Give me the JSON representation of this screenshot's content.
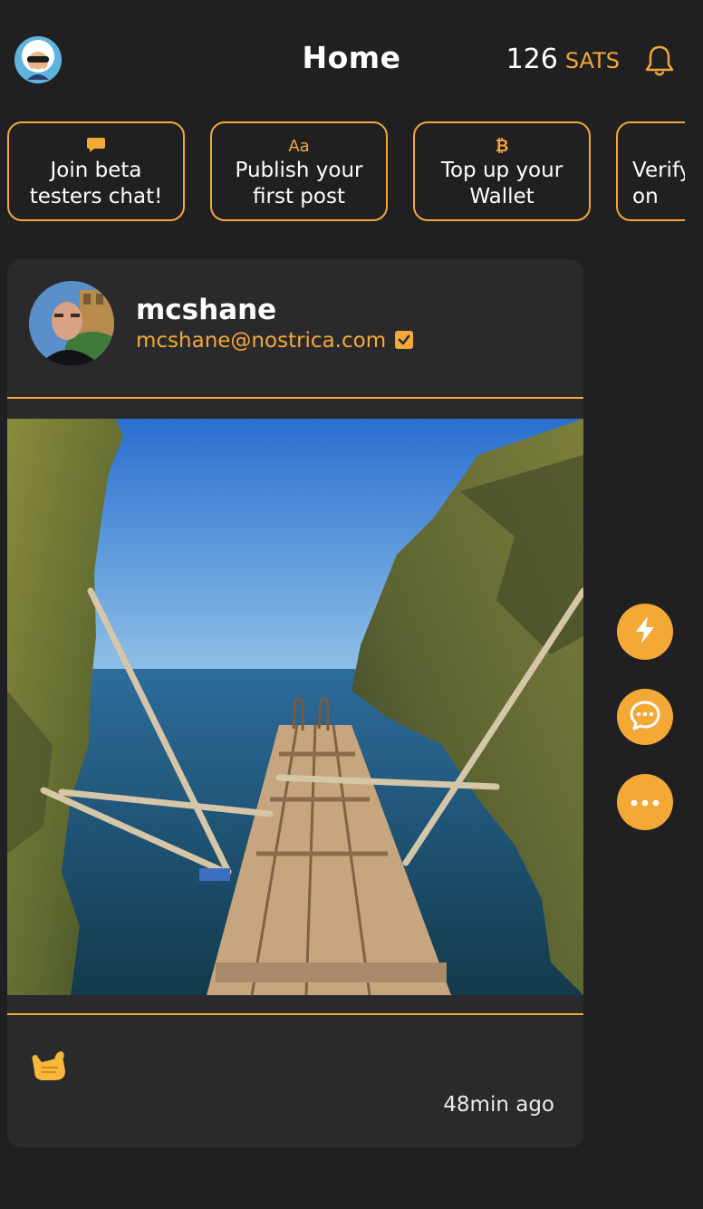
{
  "header": {
    "title": "Home",
    "sats_amount": "126",
    "sats_unit": "SATS",
    "avatar_icon": "user-avatar-icon",
    "bell_icon": "bell-icon"
  },
  "chips": [
    {
      "icon": "chat-bubble-icon",
      "label": "Join beta\ntesters chat!"
    },
    {
      "icon": "text-format-icon",
      "icon_text": "Aa",
      "label": "Publish your\nfirst post"
    },
    {
      "icon": "bitcoin-icon",
      "icon_text": "₿",
      "label": "Top up your\nWallet"
    },
    {
      "icon": "",
      "label": "Verify\non"
    }
  ],
  "post": {
    "author_name": "mcshane",
    "author_nip05": "mcshane@nostrica.com",
    "verified_icon": "verified-check-icon",
    "image_alt": "wooden pier between rocky cliffs over the sea",
    "reaction_icon": "call-me-hand-emoji-icon",
    "time_ago": "48min ago"
  },
  "actions": [
    {
      "icon": "zap-icon"
    },
    {
      "icon": "comment-icon"
    },
    {
      "icon": "more-icon"
    }
  ],
  "colors": {
    "accent": "#f4a836",
    "background": "#202022",
    "card": "#2a2a2c"
  }
}
